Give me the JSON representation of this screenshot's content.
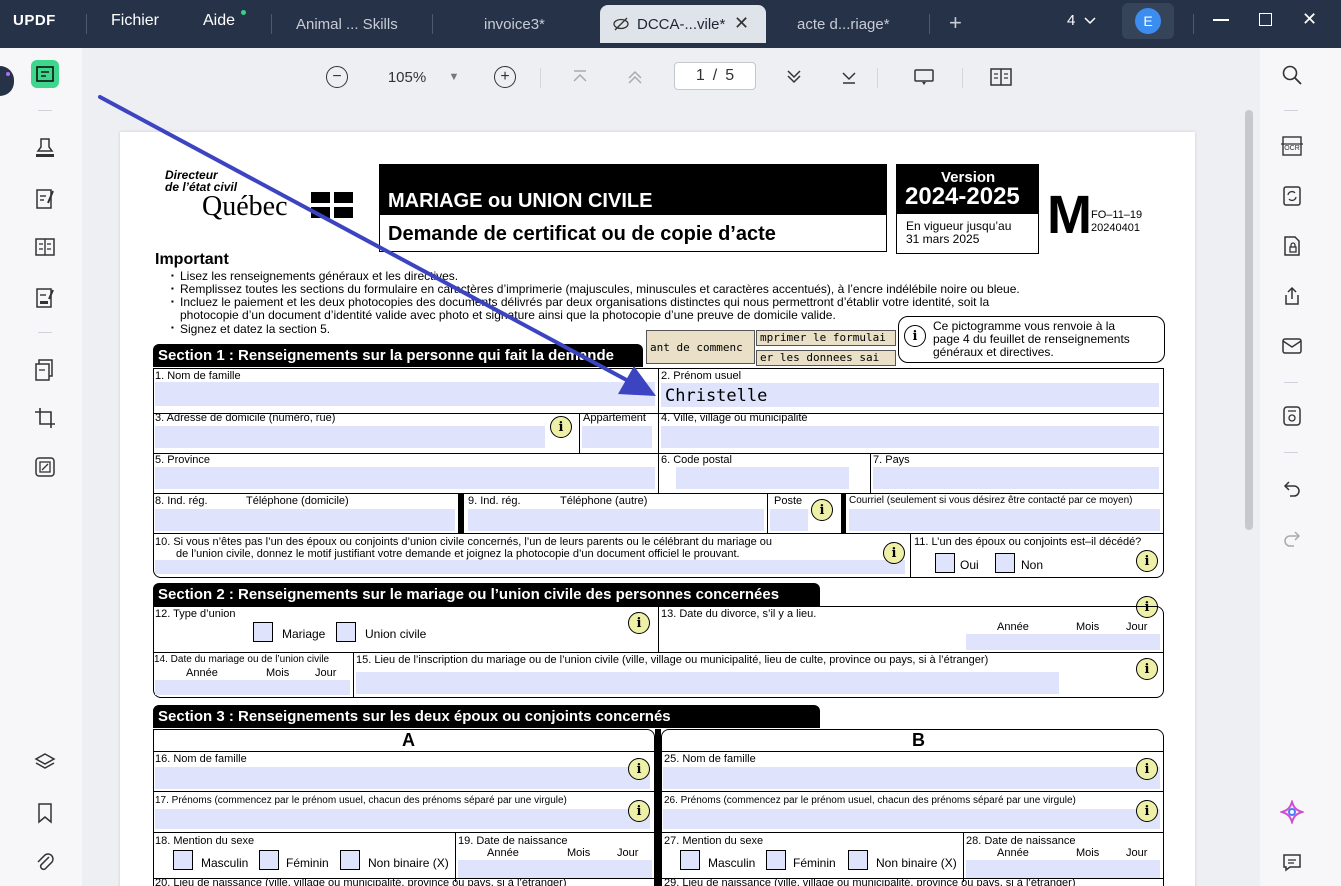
{
  "titlebar": {
    "logo": "UPDF",
    "menu": [
      "Fichier",
      "Aide"
    ],
    "tabs": [
      "Animal ... Skills",
      "invoice3*",
      "DCCA-...vile*",
      "acte d...riage*"
    ],
    "window_count": "4",
    "avatar": "E"
  },
  "toolbar": {
    "zoom": "105%",
    "page_current": "1",
    "page_sep": "/",
    "page_total": "5"
  },
  "form": {
    "dir_line1": "Directeur",
    "dir_line2": "de l’état civil",
    "quebec": "Québec",
    "title1": "MARIAGE ou UNION CIVILE",
    "title2": "Demande de certificat ou de copie d’acte",
    "version_label": "Version",
    "version_years": "2024-2025",
    "vigueur1": "En vigueur jusqu’au",
    "vigueur2": "31 mars 2025",
    "m_letter": "M",
    "code1": "FO–11–19",
    "code2": "20240401",
    "important": "Important",
    "bullets": [
      "Lisez les renseignements généraux et les directives.",
      "Remplissez toutes les sections du formulaire en caractères d’imprimerie (majuscules, minuscules et caractères accentués), à l’encre indélébile noire ou bleue.",
      "Incluez le paiement et les deux photocopies des documents délivrés par deux organisations distinctes qui nous permettront d’établir votre identité, soit la",
      "photocopie d’un document d’identité valide avec photo et signature ainsi que la photocopie d’une preuve de domicile valide.",
      "Signez et datez la section 5."
    ],
    "btn1": "ant de commenc",
    "btn2": "mprimer le formulai",
    "btn3": "er les donnees sai",
    "picto_text1": "Ce pictogramme vous renvoie à la",
    "picto_text2": "page 4 du feuillet de renseignements",
    "picto_text3": "généraux et directives.",
    "sec1": "Section 1 : Renseignements sur la personne qui fait la demande",
    "f1": "1. Nom de famille",
    "f2": "2. Prénom usuel",
    "f2_value": "Christelle",
    "f3": "3. Adresse de domicile (numéro, rue)",
    "f3b": "Appartement",
    "f4": "4. Ville, village ou municipalité",
    "f5": "5. Province",
    "f6": "6. Code postal",
    "f7": "7. Pays",
    "f8": "8. Ind. rég.",
    "f8b": "Téléphone (domicile)",
    "f9": "9. Ind. rég.",
    "f9b": "Téléphone (autre)",
    "f9c": "Poste",
    "f9d": "Courriel (seulement si vous désirez être contacté par ce moyen)",
    "f10a": "10. Si vous n’êtes pas l’un des époux ou conjoints d’union civile concernés, l’un de leurs parents ou le célébrant du mariage ou",
    "f10b": "de l’union civile, donnez le motif justifiant votre demande et joignez la photocopie d’un document officiel le prouvant.",
    "f11": "11. L’un des époux ou conjoints est–il décédé?",
    "oui": "Oui",
    "non": "Non",
    "sec2": "Section 2 : Renseignements sur le mariage ou l’union civile des personnes concernées",
    "f12": "12. Type d’union",
    "mariage": "Mariage",
    "union": "Union civile",
    "f13": "13. Date du divorce, s’il y a lieu.",
    "annee": "Année",
    "mois": "Mois",
    "jour": "Jour",
    "f14": "14. Date du mariage ou de l’union civile",
    "f15": "15. Lieu de l’inscription du mariage ou de l’union civile (ville, village ou municipalité, lieu de culte, province ou pays, si à l’étranger)",
    "sec3": "Section 3 : Renseignements sur les deux époux ou conjoints concernés",
    "colA": "A",
    "colB": "B",
    "f16": "16. Nom de famille",
    "f25": "25. Nom de famille",
    "f17": "17. Prénoms (commencez par le prénom usuel, chacun des prénoms séparé par une virgule)",
    "f26": "26. Prénoms (commencez par le prénom usuel, chacun des prénoms séparé par une virgule)",
    "f18": "18. Mention du sexe",
    "f27": "27. Mention du sexe",
    "masc": "Masculin",
    "fem": "Féminin",
    "nonbin": "Non binaire (X)",
    "f19": "19. Date de naissance",
    "f28": "28. Date de naissance",
    "f20": "20. Lieu de naissance (ville, village ou municipalité, province ou pays, si à l’étranger)",
    "f29": "29. Lieu de naissance (ville, village ou municipalité, province ou pays, si à l’étranger)"
  },
  "colors": {
    "titlebar": "#263247",
    "accent": "#3b4cc0",
    "arrow": "#3c44c2",
    "field": "#dfe3fb"
  }
}
